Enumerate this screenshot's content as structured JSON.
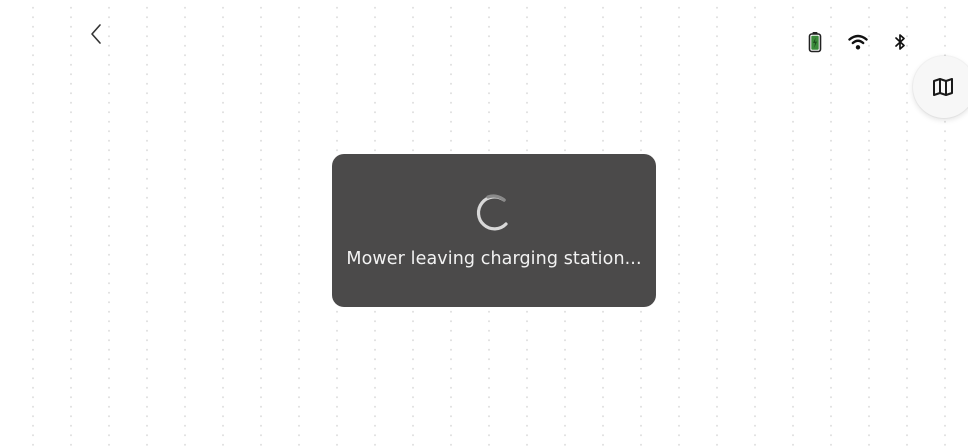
{
  "header": {
    "back_icon": "chevron-left-icon"
  },
  "status_bar": {
    "battery_icon": "battery-charging-icon",
    "battery_color": "#3a8a3a",
    "wifi_icon": "wifi-icon",
    "bluetooth_icon": "bluetooth-icon"
  },
  "map_button": {
    "icon": "map-icon"
  },
  "toast": {
    "spinner_icon": "loading-spinner-icon",
    "message": "Mower leaving charging station...",
    "background": "#4b4a4a"
  }
}
